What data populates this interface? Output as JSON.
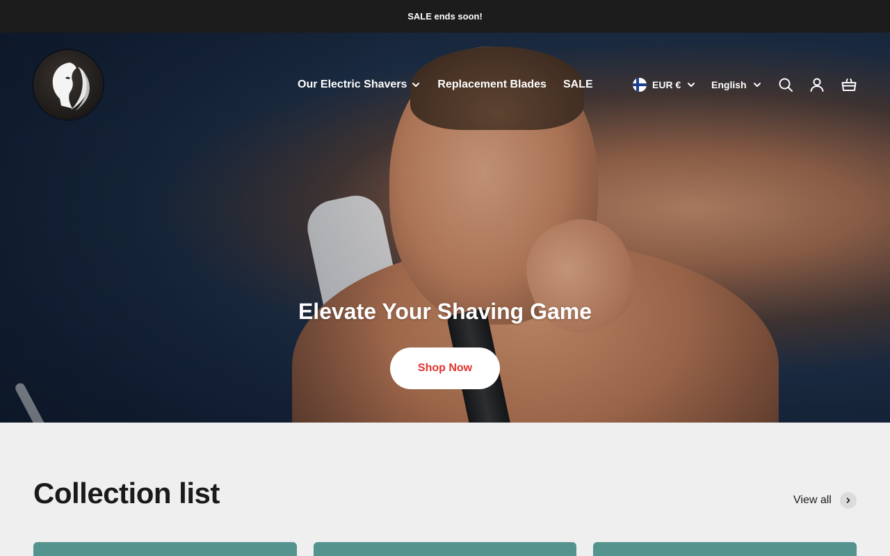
{
  "announcement": {
    "text": "SALE ends soon!"
  },
  "header": {
    "logo_name": "brand-logo",
    "nav": [
      {
        "label": "Our Electric Shavers",
        "has_dropdown": true
      },
      {
        "label": "Replacement Blades",
        "has_dropdown": false
      },
      {
        "label": "SALE",
        "has_dropdown": false
      }
    ],
    "currency": {
      "label": "EUR €",
      "flag": "finland-flag-icon"
    },
    "language": {
      "label": "English"
    },
    "icons": [
      "search-icon",
      "account-icon",
      "cart-icon"
    ]
  },
  "hero": {
    "title": "Elevate Your Shaving Game",
    "button_label": "Shop Now",
    "button_text_color": "#e0322d"
  },
  "collection": {
    "title": "Collection list",
    "view_all_label": "View all",
    "card_color": "#55938f"
  },
  "colors": {
    "announcement_bg": "#1c1c1c",
    "page_bg": "#efefef",
    "text_dark": "#1a1a1a"
  }
}
